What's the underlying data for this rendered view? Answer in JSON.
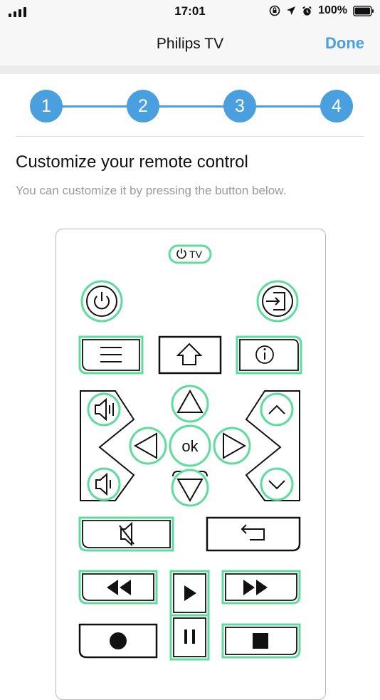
{
  "status_bar": {
    "time": "17:01",
    "battery": "100%",
    "icons": [
      "signal-icon",
      "rotation-lock-icon",
      "location-icon",
      "alarm-icon",
      "battery-icon"
    ]
  },
  "nav": {
    "title": "Philips TV",
    "done_label": "Done"
  },
  "stepper": {
    "steps": [
      "1",
      "2",
      "3",
      "4"
    ],
    "active_step": 4
  },
  "content": {
    "heading": "Customize your remote control",
    "subheading": "You can customize it by pressing the button below."
  },
  "remote": {
    "tv_label": "TV",
    "ok_label": "ok",
    "highlight_color": "#5ddc9c",
    "buttons": [
      "tv-power",
      "power",
      "input",
      "menu",
      "home",
      "info",
      "volume-up",
      "up",
      "channel-up",
      "left",
      "ok",
      "right",
      "volume-down",
      "down",
      "channel-down",
      "mute",
      "back",
      "rewind",
      "play",
      "fast-forward",
      "record",
      "pause",
      "stop"
    ]
  },
  "colors": {
    "accent": "#4aa0df",
    "highlight": "#5ddc9c"
  }
}
